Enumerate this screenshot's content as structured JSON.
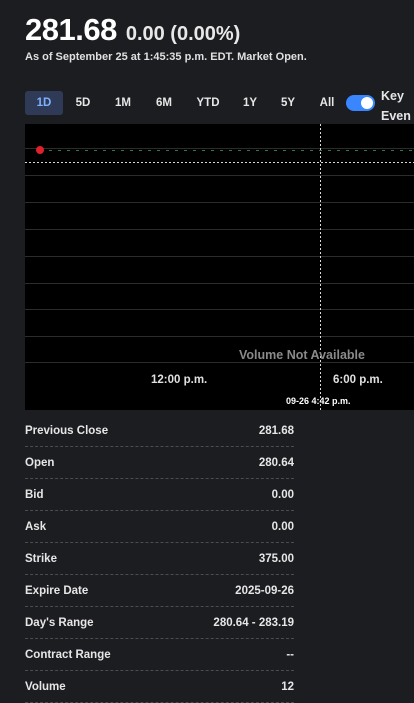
{
  "quote": {
    "price": "281.68",
    "change": "0.00 (0.00%)",
    "as_of": "As of September 25 at 1:45:35 p.m. EDT. Market Open."
  },
  "ranges": [
    {
      "label": "1D",
      "active": true
    },
    {
      "label": "5D",
      "active": false
    },
    {
      "label": "1M",
      "active": false
    },
    {
      "label": "6M",
      "active": false
    },
    {
      "label": "YTD",
      "active": false
    },
    {
      "label": "1Y",
      "active": false
    },
    {
      "label": "5Y",
      "active": false
    },
    {
      "label": "All",
      "active": false
    }
  ],
  "key_events": {
    "line1": "Key",
    "line2": "Even",
    "enabled": true
  },
  "chart": {
    "volume_message": "Volume Not Available",
    "x_ticks": [
      "12:00 p.m.",
      "6:00 p.m."
    ],
    "crosshair_label": "09-26 4:42 p.m.",
    "marker_color": "#e0202c",
    "line_color": "#2e7d4f"
  },
  "stats": [
    {
      "label": "Previous Close",
      "value": "281.68"
    },
    {
      "label": "Open",
      "value": "280.64"
    },
    {
      "label": "Bid",
      "value": "0.00"
    },
    {
      "label": "Ask",
      "value": "0.00"
    },
    {
      "label": "Strike",
      "value": "375.00"
    },
    {
      "label": "Expire Date",
      "value": "2025-09-26"
    },
    {
      "label": "Day's Range",
      "value": "280.64 - 283.19"
    },
    {
      "label": "Contract Range",
      "value": "--"
    },
    {
      "label": "Volume",
      "value": "12"
    }
  ]
}
